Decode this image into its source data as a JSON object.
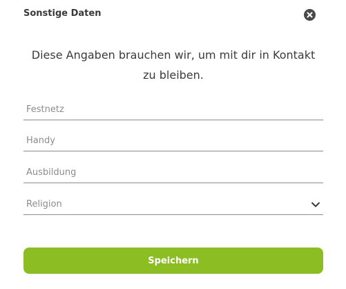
{
  "modal": {
    "title": "Sonstige Daten",
    "close_icon": "close-circle-icon",
    "intro_text": "Diese Angaben brauchen wir, um mit dir in Kontakt zu bleiben."
  },
  "form": {
    "festnetz": {
      "placeholder": "Festnetz",
      "value": ""
    },
    "handy": {
      "placeholder": "Handy",
      "value": ""
    },
    "ausbildung": {
      "placeholder": "Ausbildung",
      "value": ""
    },
    "religion": {
      "selected_label": "Religion",
      "icon": "chevron-down-icon"
    }
  },
  "actions": {
    "save_label": "Speichern"
  },
  "colors": {
    "primary": "#8cbe24",
    "close_icon_bg": "#4a4a4a",
    "underline": "#8a8a8a",
    "text": "#3a3a3a",
    "placeholder": "#8c8c8c"
  }
}
